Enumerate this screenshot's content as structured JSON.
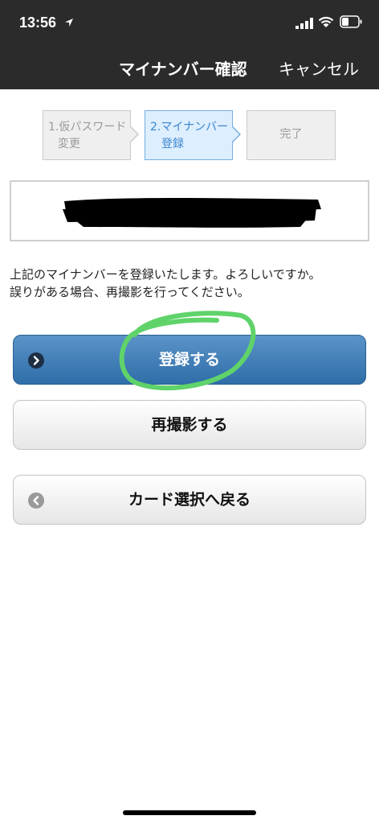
{
  "status_bar": {
    "time": "13:56",
    "icons": [
      "location-arrow-icon",
      "cellular-signal-icon",
      "wifi-icon",
      "battery-icon"
    ]
  },
  "nav": {
    "title": "マイナンバー確認",
    "cancel_label": "キャンセル"
  },
  "steps": [
    {
      "line1": "1.仮パスワード",
      "line2": "変更",
      "state": "done"
    },
    {
      "line1": "2.マイナンバー",
      "line2": "登録",
      "state": "current"
    },
    {
      "line1": "完了",
      "state": "pending"
    }
  ],
  "message": {
    "line1": "上記のマイナンバーを登録いたします。よろしいですか。",
    "line2": "誤りがある場合、再撮影を行ってください。"
  },
  "buttons": {
    "register": "登録する",
    "retake": "再撮影する",
    "back": "カード選択へ戻る"
  },
  "colors": {
    "header_bg": "#2b2b2b",
    "primary_button": "#3f7fb9",
    "active_step": "#3c86cf",
    "annotation": "#5fd36a"
  }
}
